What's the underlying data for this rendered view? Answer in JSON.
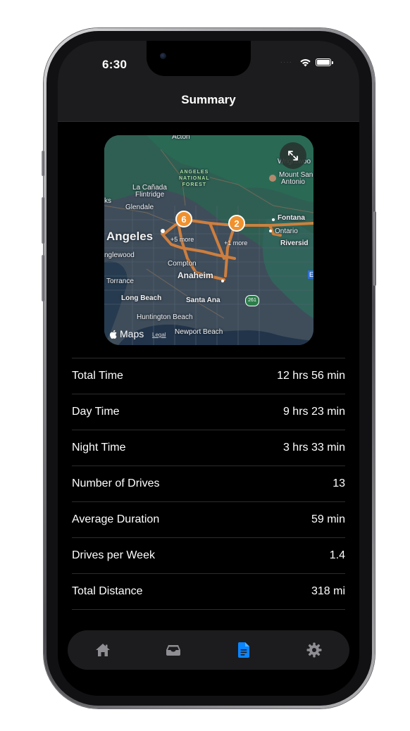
{
  "status_bar": {
    "time": "6:30",
    "signal_dots": "····"
  },
  "nav": {
    "title": "Summary"
  },
  "map": {
    "labels": {
      "acton": "Acton",
      "forest_line1": "ANGELES",
      "forest_line2": "NATIONAL",
      "forest_line3": "FOREST",
      "wrightwood": "Wrightwoo",
      "mount_san_antonio_1": "Mount San",
      "mount_san_antonio_2": "Antonio",
      "la_canada_1": "La Cañada",
      "la_canada_2": "Flintridge",
      "ks": "ks",
      "glendale": "Glendale",
      "angeles": "Angeles",
      "fontana": "Fontana",
      "ontario": "Ontario",
      "riverside": "Riversid",
      "inglewood": "nglewood",
      "compton": "Compton",
      "anaheim": "Anaheim",
      "torrance": "Torrance",
      "long_beach": "Long Beach",
      "santa_ana": "Santa Ana",
      "highway": "261",
      "huntington_beach": "Huntington Beach",
      "newport_beach": "Newport Beach",
      "e": "E"
    },
    "clusters": [
      {
        "count": "6",
        "more": "+5 more"
      },
      {
        "count": "2",
        "more": "+1 more"
      }
    ],
    "attribution": "Maps",
    "legal": "Legal"
  },
  "stats": [
    {
      "label": "Total Time",
      "value": "12 hrs 56 min"
    },
    {
      "label": "Day Time",
      "value": "9 hrs 23 min"
    },
    {
      "label": "Night Time",
      "value": "3 hrs 33 min"
    },
    {
      "label": "Number of Drives",
      "value": "13"
    },
    {
      "label": "Average Duration",
      "value": "59 min"
    },
    {
      "label": "Drives per Week",
      "value": "1.4"
    },
    {
      "label": "Total Distance",
      "value": "318 mi"
    }
  ],
  "tabs": [
    {
      "icon": "house-icon",
      "selected": false
    },
    {
      "icon": "tray-icon",
      "selected": false
    },
    {
      "icon": "document-icon",
      "selected": true
    },
    {
      "icon": "gear-icon",
      "selected": false
    }
  ],
  "colors": {
    "accent": "#0a84ff",
    "tab_inactive": "#8e8e93",
    "cluster": "#f0912e",
    "route": "#e8873a"
  }
}
